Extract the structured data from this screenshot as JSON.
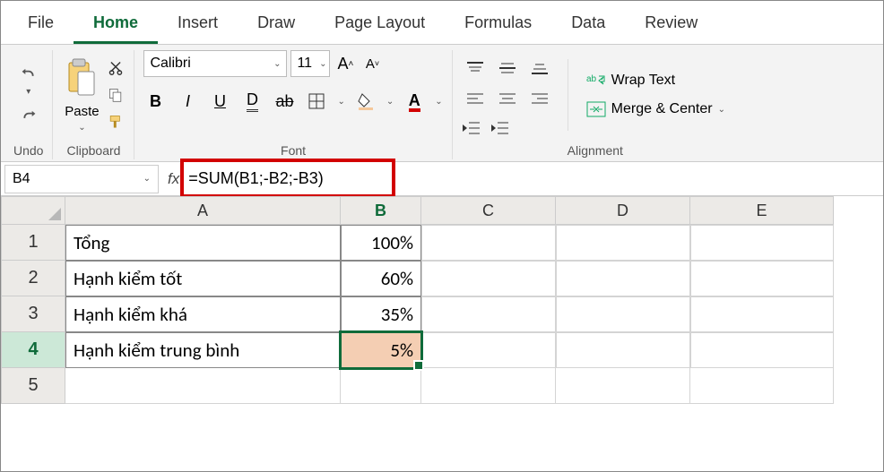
{
  "tabs": [
    "File",
    "Home",
    "Insert",
    "Draw",
    "Page Layout",
    "Formulas",
    "Data",
    "Review"
  ],
  "active_tab": "Home",
  "groups": {
    "undo": "Undo",
    "clipboard": "Clipboard",
    "font": "Font",
    "alignment": "Alignment"
  },
  "clipboard": {
    "paste": "Paste"
  },
  "font": {
    "name": "Calibri",
    "size": "11"
  },
  "align": {
    "wrap": "Wrap Text",
    "merge": "Merge & Center"
  },
  "name_box": "B4",
  "fx": "fx",
  "formula": "=SUM(B1;-B2;-B3)",
  "cols": [
    "A",
    "B",
    "C",
    "D",
    "E"
  ],
  "active_col": "B",
  "rows": [
    "1",
    "2",
    "3",
    "4",
    "5"
  ],
  "active_row": "4",
  "data": {
    "A1": "Tổng",
    "B1": "100%",
    "A2": "Hạnh kiểm tốt",
    "B2": "60%",
    "A3": "Hạnh kiểm khá",
    "B3": "35%",
    "A4": "Hạnh kiểm trung bình",
    "B4": "5%"
  }
}
